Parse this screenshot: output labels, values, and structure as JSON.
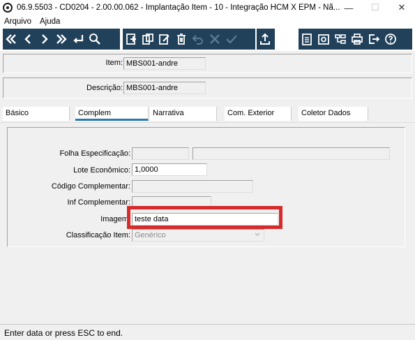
{
  "window": {
    "title": "06.9.5503 - CD0204 - 2.00.00.062 - Implantação Item - 10 - Integração HCM X EPM - Nã...",
    "minimize": "—",
    "maximize": "☐",
    "close": "✕"
  },
  "menu": {
    "items": [
      "Arquivo",
      "Ajuda"
    ]
  },
  "toolbar": {
    "nav_icons": [
      "first-icon",
      "previous-icon",
      "next-icon",
      "last-icon",
      "goto-icon",
      "search-icon"
    ],
    "edit_icons": [
      "add-icon",
      "copy-icon",
      "edit-icon",
      "delete-icon",
      "undo-icon",
      "cancel-icon",
      "save-icon"
    ],
    "export_icon": "upload-icon",
    "right_icons": [
      "notes-icon",
      "camera-icon",
      "hierarchy-icon",
      "print-icon",
      "exit-icon",
      "help-icon"
    ],
    "color": "#21405a"
  },
  "header": {
    "item_label": "Item:",
    "item_value": "MBS001-andre",
    "description_label": "Descrição:",
    "description_value": "MBS001-andre"
  },
  "tabs": [
    {
      "label": "Básico",
      "active": false
    },
    {
      "label": "Complem",
      "active": true
    },
    {
      "label": "Narrativa",
      "active": false
    },
    {
      "label": "Com. Exterior",
      "active": false
    },
    {
      "label": "Coletor Dados",
      "active": false
    }
  ],
  "form": {
    "folha_label": "Folha Especificação:",
    "folha_value": "",
    "folha_value2": "",
    "lote_label": "Lote Econômico:",
    "lote_value": "1,0000",
    "codigo_label": "Código Complementar:",
    "codigo_value": "",
    "inf_label": "Inf Complementar:",
    "inf_value": "",
    "imagem_label": "Imagem:",
    "imagem_value": "teste data",
    "classificacao_label": "Classificação Item:",
    "classificacao_value": "Genérico"
  },
  "status": {
    "text": "Enter data or press ESC to end."
  },
  "highlight_color": "#d62b2b"
}
